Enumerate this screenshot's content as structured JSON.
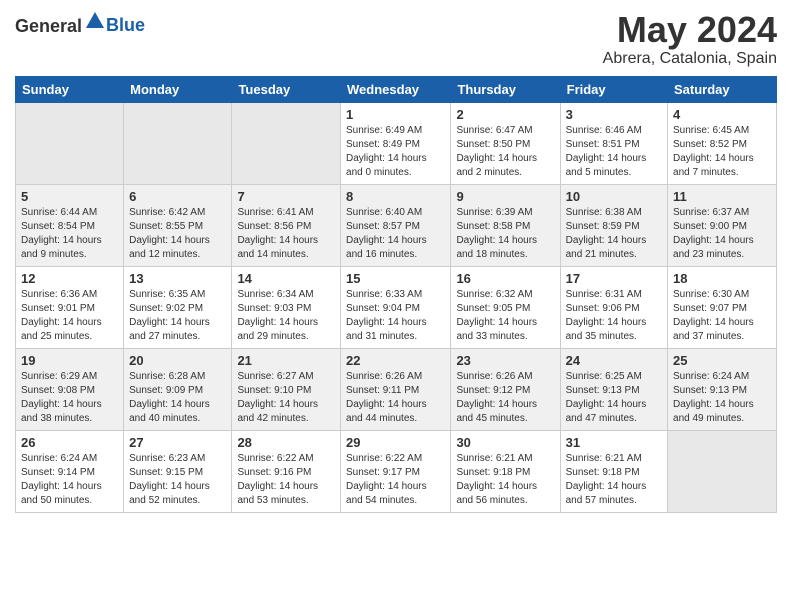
{
  "header": {
    "logo_general": "General",
    "logo_blue": "Blue",
    "title": "May 2024",
    "location": "Abrera, Catalonia, Spain"
  },
  "columns": [
    "Sunday",
    "Monday",
    "Tuesday",
    "Wednesday",
    "Thursday",
    "Friday",
    "Saturday"
  ],
  "weeks": [
    [
      {
        "day": "",
        "sunrise": "",
        "sunset": "",
        "daylight": "",
        "empty": true
      },
      {
        "day": "",
        "sunrise": "",
        "sunset": "",
        "daylight": "",
        "empty": true
      },
      {
        "day": "",
        "sunrise": "",
        "sunset": "",
        "daylight": "",
        "empty": true
      },
      {
        "day": "1",
        "sunrise": "Sunrise: 6:49 AM",
        "sunset": "Sunset: 8:49 PM",
        "daylight": "Daylight: 14 hours and 0 minutes."
      },
      {
        "day": "2",
        "sunrise": "Sunrise: 6:47 AM",
        "sunset": "Sunset: 8:50 PM",
        "daylight": "Daylight: 14 hours and 2 minutes."
      },
      {
        "day": "3",
        "sunrise": "Sunrise: 6:46 AM",
        "sunset": "Sunset: 8:51 PM",
        "daylight": "Daylight: 14 hours and 5 minutes."
      },
      {
        "day": "4",
        "sunrise": "Sunrise: 6:45 AM",
        "sunset": "Sunset: 8:52 PM",
        "daylight": "Daylight: 14 hours and 7 minutes."
      }
    ],
    [
      {
        "day": "5",
        "sunrise": "Sunrise: 6:44 AM",
        "sunset": "Sunset: 8:54 PM",
        "daylight": "Daylight: 14 hours and 9 minutes."
      },
      {
        "day": "6",
        "sunrise": "Sunrise: 6:42 AM",
        "sunset": "Sunset: 8:55 PM",
        "daylight": "Daylight: 14 hours and 12 minutes."
      },
      {
        "day": "7",
        "sunrise": "Sunrise: 6:41 AM",
        "sunset": "Sunset: 8:56 PM",
        "daylight": "Daylight: 14 hours and 14 minutes."
      },
      {
        "day": "8",
        "sunrise": "Sunrise: 6:40 AM",
        "sunset": "Sunset: 8:57 PM",
        "daylight": "Daylight: 14 hours and 16 minutes."
      },
      {
        "day": "9",
        "sunrise": "Sunrise: 6:39 AM",
        "sunset": "Sunset: 8:58 PM",
        "daylight": "Daylight: 14 hours and 18 minutes."
      },
      {
        "day": "10",
        "sunrise": "Sunrise: 6:38 AM",
        "sunset": "Sunset: 8:59 PM",
        "daylight": "Daylight: 14 hours and 21 minutes."
      },
      {
        "day": "11",
        "sunrise": "Sunrise: 6:37 AM",
        "sunset": "Sunset: 9:00 PM",
        "daylight": "Daylight: 14 hours and 23 minutes."
      }
    ],
    [
      {
        "day": "12",
        "sunrise": "Sunrise: 6:36 AM",
        "sunset": "Sunset: 9:01 PM",
        "daylight": "Daylight: 14 hours and 25 minutes."
      },
      {
        "day": "13",
        "sunrise": "Sunrise: 6:35 AM",
        "sunset": "Sunset: 9:02 PM",
        "daylight": "Daylight: 14 hours and 27 minutes."
      },
      {
        "day": "14",
        "sunrise": "Sunrise: 6:34 AM",
        "sunset": "Sunset: 9:03 PM",
        "daylight": "Daylight: 14 hours and 29 minutes."
      },
      {
        "day": "15",
        "sunrise": "Sunrise: 6:33 AM",
        "sunset": "Sunset: 9:04 PM",
        "daylight": "Daylight: 14 hours and 31 minutes."
      },
      {
        "day": "16",
        "sunrise": "Sunrise: 6:32 AM",
        "sunset": "Sunset: 9:05 PM",
        "daylight": "Daylight: 14 hours and 33 minutes."
      },
      {
        "day": "17",
        "sunrise": "Sunrise: 6:31 AM",
        "sunset": "Sunset: 9:06 PM",
        "daylight": "Daylight: 14 hours and 35 minutes."
      },
      {
        "day": "18",
        "sunrise": "Sunrise: 6:30 AM",
        "sunset": "Sunset: 9:07 PM",
        "daylight": "Daylight: 14 hours and 37 minutes."
      }
    ],
    [
      {
        "day": "19",
        "sunrise": "Sunrise: 6:29 AM",
        "sunset": "Sunset: 9:08 PM",
        "daylight": "Daylight: 14 hours and 38 minutes."
      },
      {
        "day": "20",
        "sunrise": "Sunrise: 6:28 AM",
        "sunset": "Sunset: 9:09 PM",
        "daylight": "Daylight: 14 hours and 40 minutes."
      },
      {
        "day": "21",
        "sunrise": "Sunrise: 6:27 AM",
        "sunset": "Sunset: 9:10 PM",
        "daylight": "Daylight: 14 hours and 42 minutes."
      },
      {
        "day": "22",
        "sunrise": "Sunrise: 6:26 AM",
        "sunset": "Sunset: 9:11 PM",
        "daylight": "Daylight: 14 hours and 44 minutes."
      },
      {
        "day": "23",
        "sunrise": "Sunrise: 6:26 AM",
        "sunset": "Sunset: 9:12 PM",
        "daylight": "Daylight: 14 hours and 45 minutes."
      },
      {
        "day": "24",
        "sunrise": "Sunrise: 6:25 AM",
        "sunset": "Sunset: 9:13 PM",
        "daylight": "Daylight: 14 hours and 47 minutes."
      },
      {
        "day": "25",
        "sunrise": "Sunrise: 6:24 AM",
        "sunset": "Sunset: 9:13 PM",
        "daylight": "Daylight: 14 hours and 49 minutes."
      }
    ],
    [
      {
        "day": "26",
        "sunrise": "Sunrise: 6:24 AM",
        "sunset": "Sunset: 9:14 PM",
        "daylight": "Daylight: 14 hours and 50 minutes."
      },
      {
        "day": "27",
        "sunrise": "Sunrise: 6:23 AM",
        "sunset": "Sunset: 9:15 PM",
        "daylight": "Daylight: 14 hours and 52 minutes."
      },
      {
        "day": "28",
        "sunrise": "Sunrise: 6:22 AM",
        "sunset": "Sunset: 9:16 PM",
        "daylight": "Daylight: 14 hours and 53 minutes."
      },
      {
        "day": "29",
        "sunrise": "Sunrise: 6:22 AM",
        "sunset": "Sunset: 9:17 PM",
        "daylight": "Daylight: 14 hours and 54 minutes."
      },
      {
        "day": "30",
        "sunrise": "Sunrise: 6:21 AM",
        "sunset": "Sunset: 9:18 PM",
        "daylight": "Daylight: 14 hours and 56 minutes."
      },
      {
        "day": "31",
        "sunrise": "Sunrise: 6:21 AM",
        "sunset": "Sunset: 9:18 PM",
        "daylight": "Daylight: 14 hours and 57 minutes."
      },
      {
        "day": "",
        "sunrise": "",
        "sunset": "",
        "daylight": "",
        "empty": true
      }
    ]
  ]
}
